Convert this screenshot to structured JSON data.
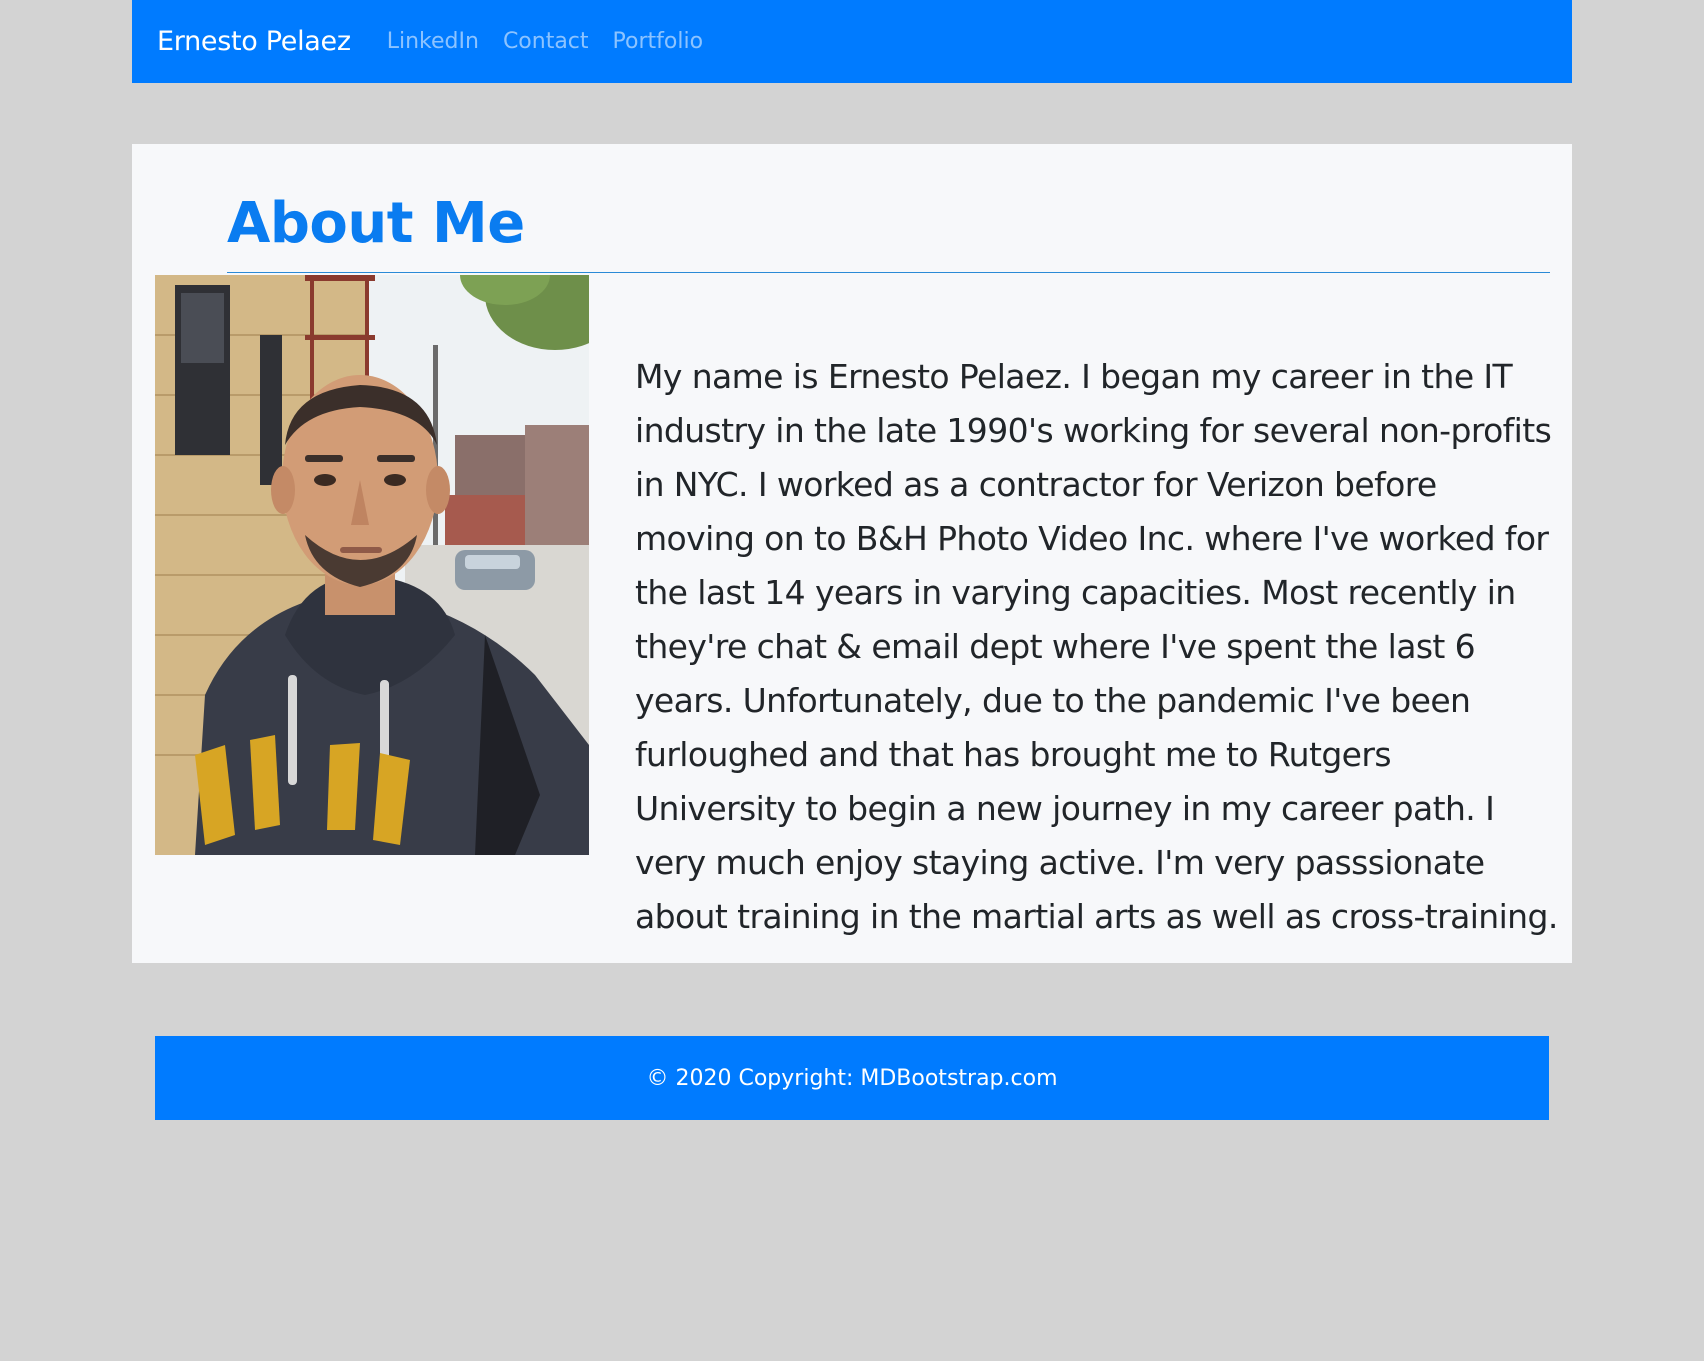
{
  "navbar": {
    "brand": "Ernesto Pelaez",
    "links": [
      "LinkedIn",
      "Contact",
      "Portfolio"
    ]
  },
  "about": {
    "heading": "About Me",
    "photo_alt": "Selfie of Ernesto Pelaez on a city sidewalk",
    "bio": "My name is Ernesto Pelaez. I began my career in the IT industry in the late 1990's working for several non-profits in NYC. I worked as a contractor for Verizon before moving on to B&H Photo Video Inc. where I've worked for the last 14 years in varying capacities. Most recently in they're chat & email dept where I've spent the last 6 years. Unfortunately, due to the pandemic I've been furloughed and that has brought me to Rutgers University to begin a new journey in my career path. I very much enjoy staying active. I'm very passsionate about training in the martial arts as well as cross-training."
  },
  "footer": {
    "copyright": "© 2020 Copyright: MDBootstrap.com"
  },
  "colors": {
    "primary": "#007bff",
    "heading": "#0a7cf0",
    "background": "#d3d3d3",
    "card": "#f7f8fa",
    "text": "#212529"
  }
}
